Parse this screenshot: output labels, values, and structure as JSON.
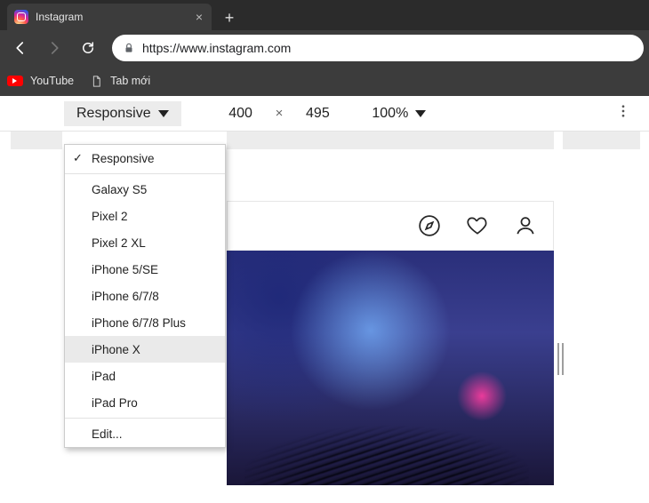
{
  "browser": {
    "tab_title": "Instagram",
    "url": "https://www.instagram.com",
    "bookmarks": [
      {
        "label": "YouTube",
        "icon": "youtube"
      },
      {
        "label": "Tab mới",
        "icon": "page"
      }
    ]
  },
  "devtools": {
    "device_label": "Responsive",
    "width": "400",
    "height": "495",
    "zoom": "100%",
    "devices": [
      {
        "label": "Responsive",
        "checked": true
      },
      {
        "label": "Galaxy S5"
      },
      {
        "label": "Pixel 2"
      },
      {
        "label": "Pixel 2 XL"
      },
      {
        "label": "iPhone 5/SE"
      },
      {
        "label": "iPhone 6/7/8"
      },
      {
        "label": "iPhone 6/7/8 Plus"
      },
      {
        "label": "iPhone X",
        "hover": true
      },
      {
        "label": "iPad"
      },
      {
        "label": "iPad Pro"
      }
    ],
    "edit_label": "Edit..."
  }
}
